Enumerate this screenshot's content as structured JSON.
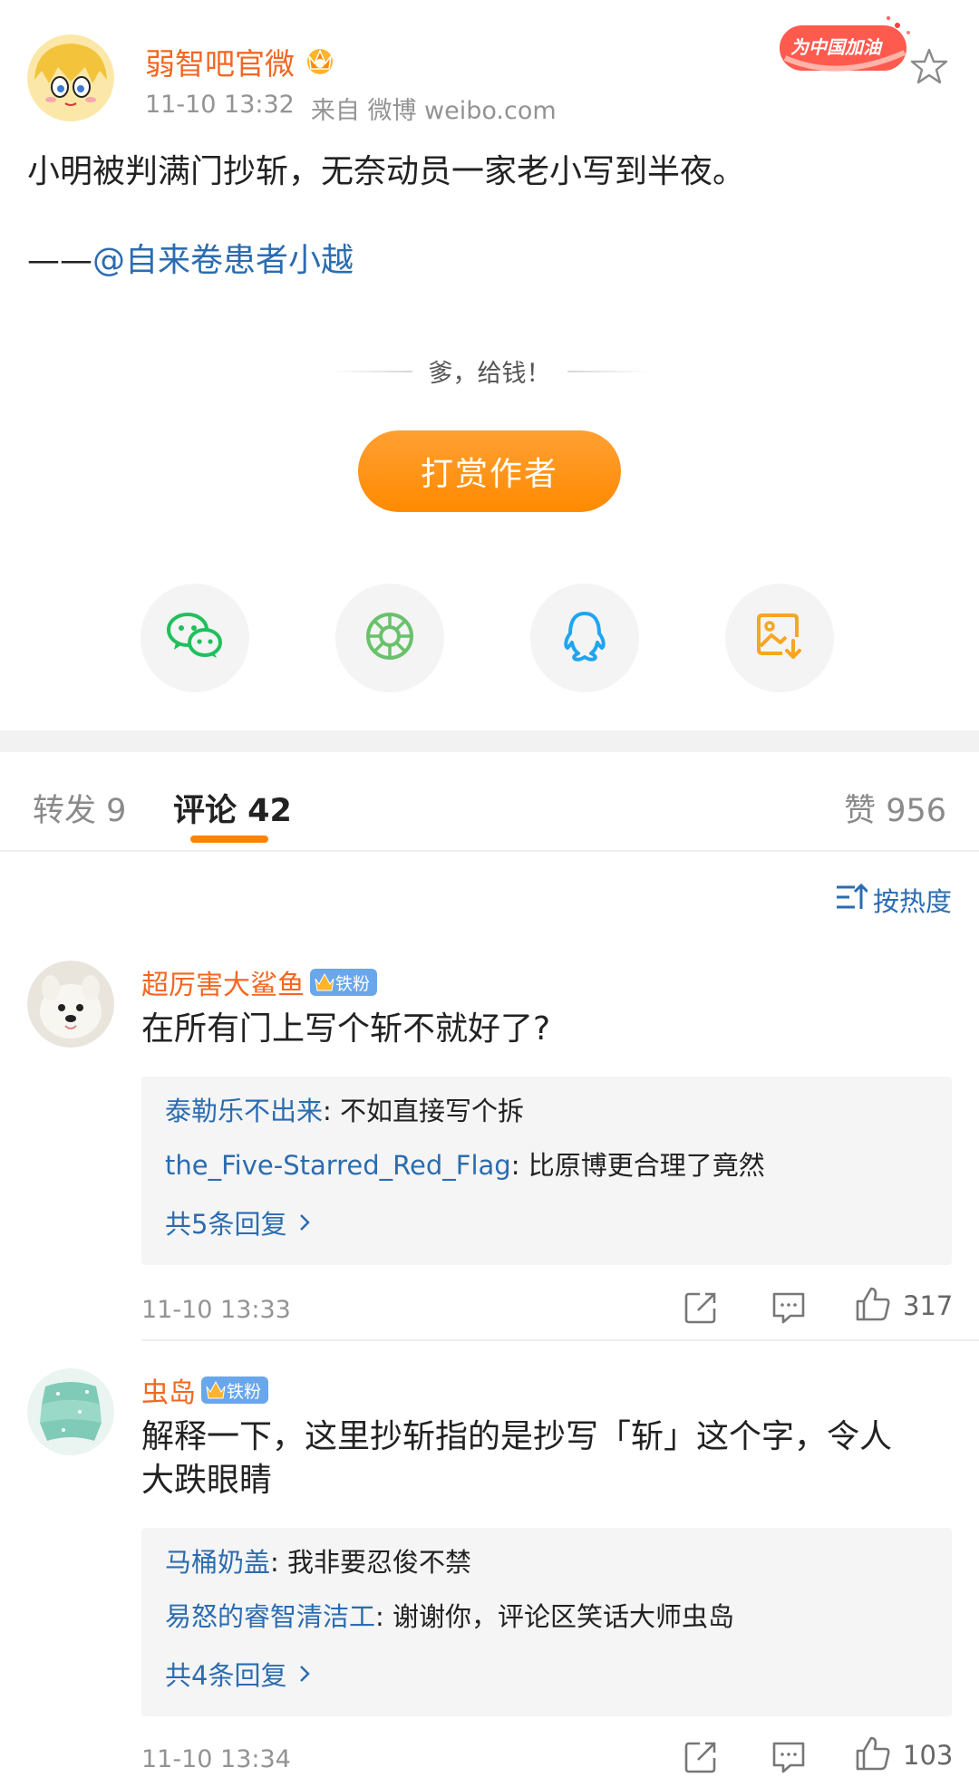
{
  "post": {
    "author": "弱智吧官微",
    "time": "11-10 13:32",
    "source": "来自 微博 weibo.com",
    "badge_text": "为中国加油",
    "text": "小明被判满门抄斩，无奈动员一家老小写到半夜。",
    "credit_prefix": "——",
    "credit_mention": "@自来卷患者小越",
    "reward_tagline": "爹，给钱！",
    "reward_button": "打赏作者"
  },
  "share": {
    "items": [
      "wechat-icon",
      "moments-icon",
      "qq-icon",
      "save-image-icon"
    ],
    "colors": [
      "#20c05c",
      "#69c26b",
      "#1fa5f0",
      "#f5a623"
    ]
  },
  "tabs": {
    "repost": "转发 9",
    "comments": "评论 42",
    "likes": "赞 956"
  },
  "sort": {
    "label": "按热度"
  },
  "comments": [
    {
      "user": "超厉害大鲨鱼",
      "badge_level": "4",
      "fan_label": "铁粉",
      "text": "在所有门上写个斩不就好了?",
      "replies": [
        {
          "user": "泰勒乐不出来",
          "sep": ": ",
          "text": "不如直接写个拆"
        },
        {
          "user": "the_Five-Starred_Red_Flag",
          "sep": ": ",
          "text": "比原博更合理了竟然"
        }
      ],
      "more": "共5条回复",
      "time": "11-10 13:33",
      "likes": "317"
    },
    {
      "user": "虫岛",
      "badge_level": "1",
      "fan_label": "铁粉",
      "text_line1": "解释一下，这里抄斩指的是抄写「斩」这个字，令人",
      "text_line2": "大跌眼睛",
      "replies": [
        {
          "user": "马桶奶盖",
          "sep": ": ",
          "text": "我非要忍俊不禁"
        },
        {
          "user": "易怒的睿智清洁工",
          "sep": ": ",
          "text": "谢谢你，评论区笑话大师虫岛"
        }
      ],
      "more": "共4条回复",
      "time": "11-10 13:34",
      "likes": "103"
    }
  ],
  "colors": {
    "accent": "#ff8200",
    "username": "#f26722",
    "link": "#2b6cb0",
    "muted": "#939393"
  }
}
